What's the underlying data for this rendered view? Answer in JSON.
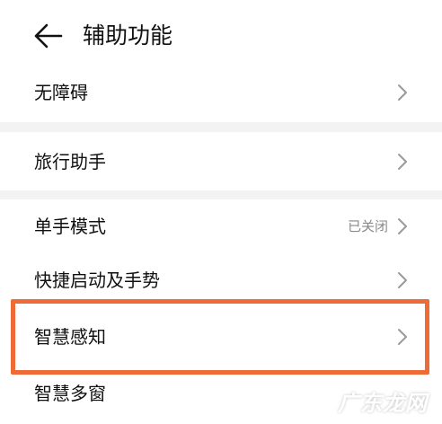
{
  "header": {
    "back_icon": "arrow-left-icon",
    "title": "辅助功能"
  },
  "sections": [
    {
      "items": [
        {
          "label": "无障碍",
          "value": "",
          "icon": "chevron-right-icon"
        }
      ]
    },
    {
      "items": [
        {
          "label": "旅行助手",
          "value": "",
          "icon": "chevron-right-icon"
        }
      ]
    },
    {
      "items": [
        {
          "label": "单手模式",
          "value": "已关闭",
          "icon": "chevron-right-icon"
        },
        {
          "label": "快捷启动及手势",
          "value": "",
          "icon": "chevron-right-icon"
        },
        {
          "label": "智慧感知",
          "value": "",
          "icon": "chevron-right-icon",
          "highlighted": true
        },
        {
          "label": "智慧多窗",
          "value": "",
          "icon": "chevron-right-icon"
        }
      ]
    }
  ],
  "colors": {
    "highlight": "#ee6b35",
    "background": "#f3f3f3",
    "card": "#ffffff",
    "secondary_text": "#8a8a8a"
  },
  "watermark": "广东龙网"
}
